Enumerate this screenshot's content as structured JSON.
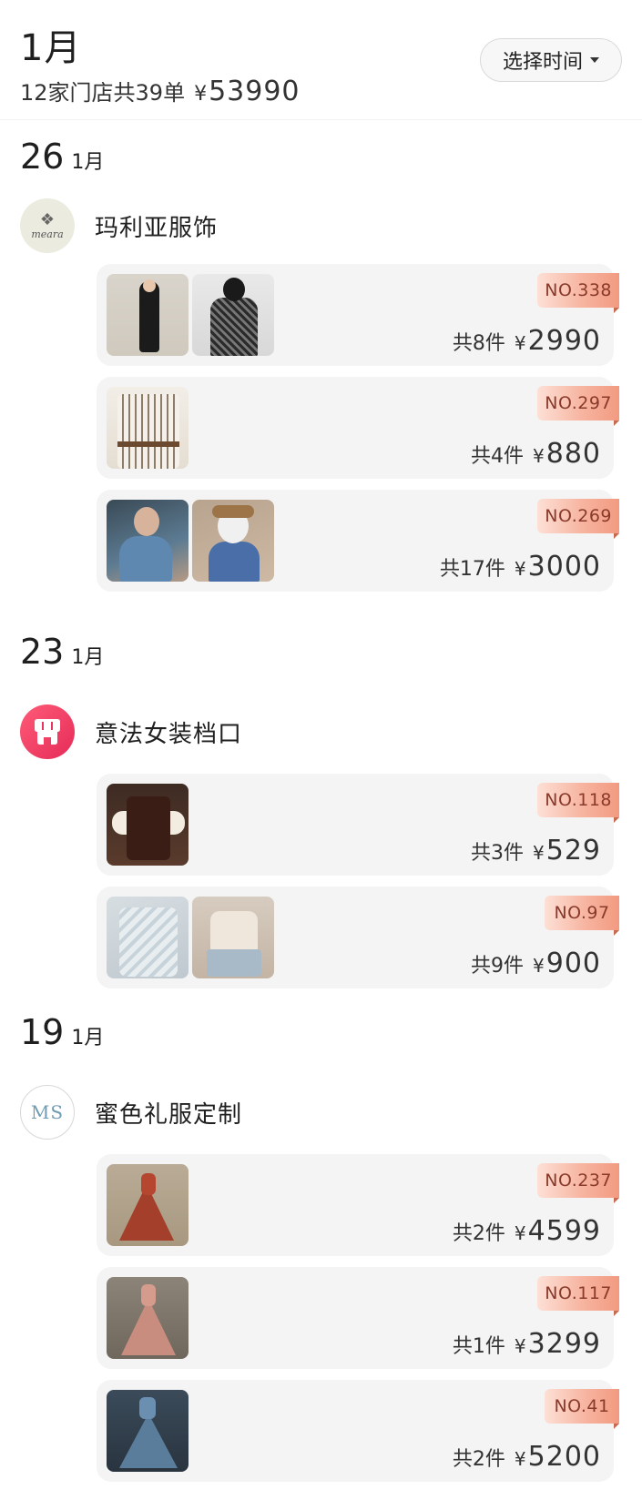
{
  "header": {
    "month_title": "1月",
    "summary_text": "12家门店共39单",
    "currency": "¥",
    "total_amount": "53990",
    "select_time_label": "选择时间"
  },
  "groups": [
    {
      "day": "26",
      "month": "1月",
      "stores": [
        {
          "name": "玛利亚服饰",
          "avatar_text": "meara",
          "orders": [
            {
              "badge": "NO.338",
              "count_text": "共8件",
              "currency": "¥",
              "price": "2990"
            },
            {
              "badge": "NO.297",
              "count_text": "共4件",
              "currency": "¥",
              "price": "880"
            },
            {
              "badge": "NO.269",
              "count_text": "共17件",
              "currency": "¥",
              "price": "3000"
            }
          ]
        }
      ]
    },
    {
      "day": "23",
      "month": "1月",
      "stores": [
        {
          "name": "意法女装档口",
          "orders": [
            {
              "badge": "NO.118",
              "count_text": "共3件",
              "currency": "¥",
              "price": "529"
            },
            {
              "badge": "NO.97",
              "count_text": "共9件",
              "currency": "¥",
              "price": "900"
            }
          ]
        }
      ]
    },
    {
      "day": "19",
      "month": "1月",
      "stores": [
        {
          "name": "蜜色礼服定制",
          "avatar_text": "MS",
          "orders": [
            {
              "badge": "NO.237",
              "count_text": "共2件",
              "currency": "¥",
              "price": "4599"
            },
            {
              "badge": "NO.117",
              "count_text": "共1件",
              "currency": "¥",
              "price": "3299"
            },
            {
              "badge": "NO.41",
              "count_text": "共2件",
              "currency": "¥",
              "price": "5200"
            }
          ]
        }
      ]
    }
  ],
  "colors": {
    "badge_start": "#fde0d6",
    "badge_end": "#f29a80",
    "badge_text": "#8a3a2a",
    "card_bg": "#f4f4f4",
    "store_icon_pink": "#e52c58"
  }
}
